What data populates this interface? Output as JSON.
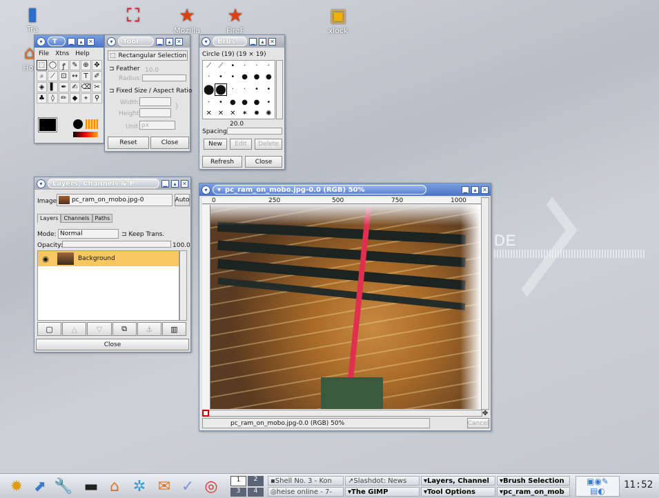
{
  "desktop": {
    "icons": [
      {
        "label": "Tra",
        "glyph": "🗑"
      },
      {
        "label": "Hor",
        "glyph": "🏠"
      },
      {
        "label": "",
        "glyph": "📄"
      },
      {
        "label": "Mozilla",
        "glyph": "★"
      },
      {
        "label": "FireF",
        "glyph": "★"
      },
      {
        "label": "xlock",
        "glyph": "🔒"
      }
    ],
    "watermark": "DE"
  },
  "toolbox": {
    "title": "T",
    "menu": [
      "File",
      "Xtns",
      "Help"
    ],
    "tools": [
      "⬚",
      "◯",
      "ꝭ",
      "✎",
      "⊕",
      "✥",
      "⌕",
      "⟋",
      "⊡",
      "↔",
      "T",
      "✐",
      "◈",
      "▌",
      "✒",
      "✍",
      "⌫",
      "✂",
      "♣",
      "◊",
      "✏",
      "◆",
      "⌖",
      "⚲"
    ]
  },
  "tool_options": {
    "title": "Tool",
    "tool_name": "Rectangular Selection",
    "feather": "Feather",
    "radius_label": "Radius:",
    "radius_value": "10.0",
    "fixed": "Fixed Size / Aspect Ratio",
    "width_label": "Width:",
    "height_label": "Height:",
    "unit_label": "Unit:",
    "unit_value": "px",
    "reset": "Reset",
    "close": "Close"
  },
  "brushes": {
    "title": "Brus",
    "brush_name": "Circle (19)  (19 × 19)",
    "spacing_value": "20.0",
    "spacing_label": "Spacing:",
    "new": "New",
    "edit": "Edit",
    "delete": "Delete",
    "refresh": "Refresh",
    "close": "Close"
  },
  "layers": {
    "title": "Layers, Channels & P",
    "image_label": "Image:",
    "image_value": "pc_ram_on_mobo.jpg-0",
    "auto": "Auto",
    "tabs": [
      "Layers",
      "Channels",
      "Paths"
    ],
    "mode_label": "Mode:",
    "mode_value": "Normal",
    "keep_trans": "Keep Trans.",
    "opacity_label": "Opacity:",
    "opacity_value": "100.0",
    "layer_name": "Background",
    "close": "Close",
    "bottom_icons": [
      "new-layer-icon",
      "raise-icon",
      "lower-icon",
      "duplicate-icon",
      "anchor-icon",
      "trash-icon"
    ]
  },
  "image_window": {
    "title": "pc_ram_on_mobo.jpg-0.0 (RGB) 50%",
    "ruler_ticks": [
      "0",
      "250",
      "500",
      "750",
      "1000"
    ],
    "status": "pc_ram_on_mobo.jpg-0.0 (RGB) 50%",
    "cancel": "Cancel"
  },
  "taskbar": {
    "desks": [
      "1",
      "2",
      "3",
      "4"
    ],
    "tasks": [
      {
        "label": "Shell No. 3 - Kon",
        "active": false
      },
      {
        "label": "heise online - 7-",
        "active": false
      },
      {
        "label": "Slashdot: News",
        "active": false
      },
      {
        "label": "The GIMP",
        "active": true
      },
      {
        "label": "Layers, Channel",
        "active": true
      },
      {
        "label": "Tool Options",
        "active": false
      },
      {
        "label": "Brush Selection",
        "active": true
      },
      {
        "label": "pc_ram_on_mob",
        "active": false
      }
    ],
    "clock": "11:52"
  }
}
